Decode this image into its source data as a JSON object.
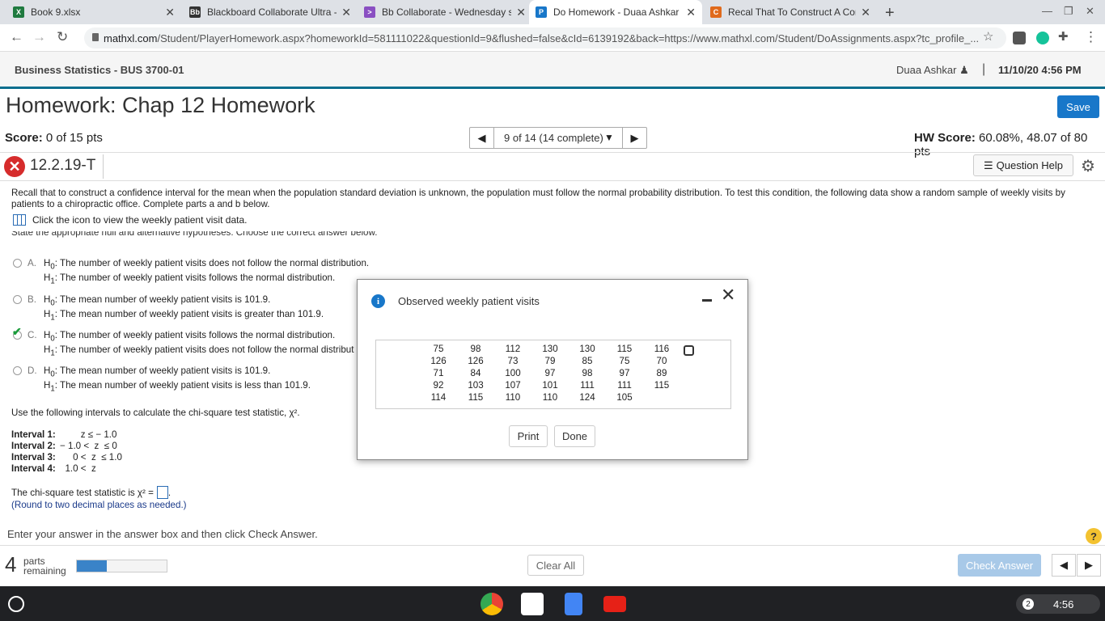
{
  "browser": {
    "tabs": [
      {
        "title": "Book 9.xlsx",
        "fav_color": "#1f7a3f",
        "fav_glyph": "X"
      },
      {
        "title": "Blackboard Collaborate Ultra - E",
        "fav_color": "#333333",
        "fav_glyph": "Bb"
      },
      {
        "title": "Bb Collaborate - Wednesday ses",
        "fav_color": "#8a4fc2",
        "fav_glyph": ">"
      },
      {
        "title": "Do Homework - Duaa Ashkar",
        "fav_color": "#1877c9",
        "fav_glyph": "P"
      },
      {
        "title": "Recal That To Construct A Confi",
        "fav_color": "#e06a1c",
        "fav_glyph": "C"
      }
    ],
    "url_host": "mathxl.com",
    "url_rest": "/Student/PlayerHomework.aspx?homeworkId=581111022&questionId=9&flushed=false&cId=6139192&back=https://www.mathxl.com/Student/DoAssignments.aspx?tc_profile_..."
  },
  "header": {
    "course": "Business Statistics - BUS 3700-01",
    "user": "Duaa Ashkar",
    "separator": "|",
    "datetime": "11/10/20 4:56 PM"
  },
  "homework": {
    "title": "Homework: Chap 12 Homework",
    "save_label": "Save",
    "score_label": "Score:",
    "score_value": "0 of 15 pts",
    "question_position": "9 of 14 (14 complete)",
    "hw_score_label": "HW Score:",
    "hw_score_value": "60.08%, 48.07 of 80 pts"
  },
  "question": {
    "id": "12.2.19-T",
    "help_label": "Question Help",
    "stem": "Recall that to construct a confidence interval for the mean when the population standard deviation is unknown, the population must follow the normal probability distribution. To test this condition, the following data show a random sample of weekly visits by patients to a chiropractic office. Complete parts a and b below.",
    "data_link": "Click the icon to view the weekly patient visit data.",
    "cut_instruction": "State the appropriate null and alternative hypotheses. Choose the correct answer below.",
    "options": [
      {
        "letter": "A.",
        "h0": "The number of weekly patient visits does not follow the normal distribution.",
        "h1": "The number of weekly patient visits follows the normal distribution.",
        "selected": false
      },
      {
        "letter": "B.",
        "h0": "The mean number of weekly patient visits is 101.9.",
        "h1": "The mean number of weekly patient visits is greater than 101.9.",
        "selected": false
      },
      {
        "letter": "C.",
        "h0": "The number of weekly patient visits follows the normal distribution.",
        "h1": "The number of weekly patient visits does not follow the normal distribut",
        "selected": true
      },
      {
        "letter": "D.",
        "h0": "The mean number of weekly patient visits is 101.9.",
        "h1": "The mean number of weekly patient visits is less than 101.9.",
        "selected": false
      }
    ],
    "use_intervals": "Use the following intervals to calculate the chi-square test statistic, χ².",
    "intervals": [
      {
        "label": "Interval 1:",
        "expr": "        z ≤ − 1.0"
      },
      {
        "label": "Interval 2:",
        "expr": "− 1.0 <  z  ≤ 0"
      },
      {
        "label": "Interval 3:",
        "expr": "     0 <  z  ≤ 1.0"
      },
      {
        "label": "Interval 4:",
        "expr": "  1.0 <  z"
      }
    ],
    "chi_prompt": "The chi-square test statistic is χ² =",
    "chi_suffix": ".",
    "round_note": "(Round to two decimal places as needed.)",
    "enter_instruction": "Enter your answer in the answer box and then click Check Answer."
  },
  "footer": {
    "parts_number": "4",
    "parts_label_1": "parts",
    "parts_label_2": "remaining",
    "progress_fraction": 0.33,
    "clear_all_label": "Clear All",
    "check_answer_label": "Check Answer"
  },
  "modal": {
    "title": "Observed weekly patient visits",
    "rows": [
      [
        "75",
        "98",
        "112",
        "130",
        "130",
        "115",
        "116"
      ],
      [
        "126",
        "126",
        "73",
        "79",
        "85",
        "75",
        "70"
      ],
      [
        "71",
        "84",
        "100",
        "97",
        "98",
        "97",
        "89"
      ],
      [
        "92",
        "103",
        "107",
        "101",
        "111",
        "111",
        "115"
      ],
      [
        "114",
        "115",
        "110",
        "110",
        "124",
        "105",
        ""
      ]
    ],
    "print_label": "Print",
    "done_label": "Done"
  },
  "taskbar": {
    "notification_count": "2",
    "time": "4:56"
  }
}
